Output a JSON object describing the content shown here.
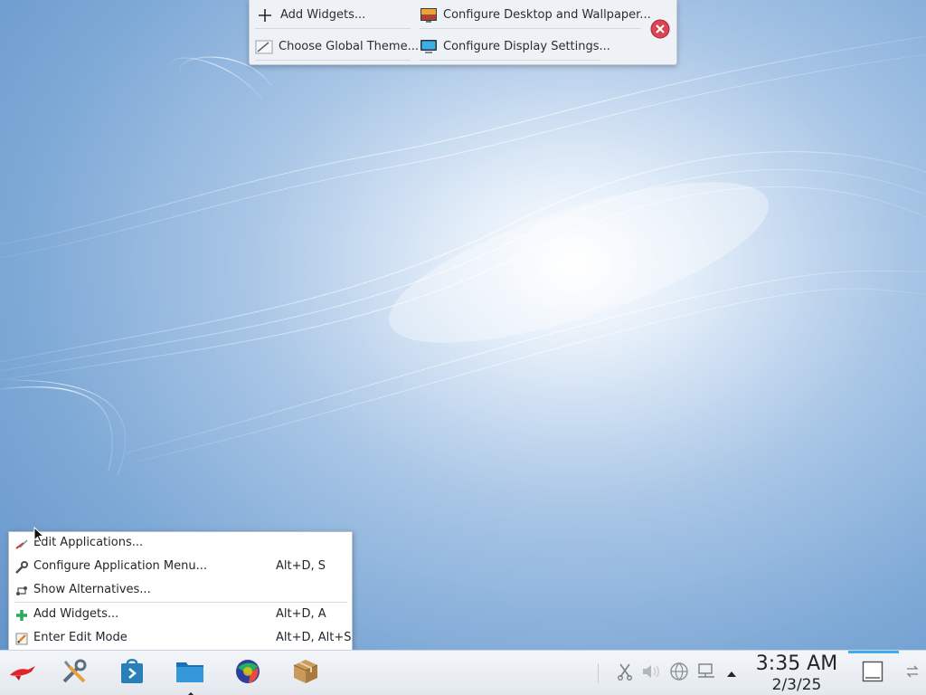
{
  "top_toolbar": {
    "add_widgets": "Add Widgets...",
    "configure_desktop": "Configure Desktop and Wallpaper...",
    "global_theme": "Choose Global Theme...",
    "display_settings": "Configure Display Settings..."
  },
  "context_menu": {
    "items": [
      {
        "label": "Edit Applications...",
        "shortcut": "",
        "icon": "edit-applications-icon"
      },
      {
        "label": "Configure Application Menu...",
        "shortcut": "Alt+D, S",
        "icon": "wrench-icon"
      },
      {
        "label": "Show Alternatives...",
        "shortcut": "",
        "icon": "alternatives-icon"
      },
      {
        "label": "Add Widgets...",
        "shortcut": "Alt+D, A",
        "icon": "plus-icon"
      },
      {
        "label": "Enter Edit Mode",
        "shortcut": "Alt+D, Alt+S",
        "icon": "pencil-icon"
      }
    ]
  },
  "taskbar": {
    "launchers": [
      "application-launcher-icon",
      "system-settings-icon",
      "discover-store-icon",
      "file-manager-icon",
      "web-browser-icon",
      "package-icon"
    ],
    "tray": [
      "clipboard-icon",
      "volume-icon",
      "network-icon",
      "display-icon",
      "expand-tray-icon"
    ],
    "clock_time": "3:35 AM",
    "clock_date": "2/3/25"
  },
  "colors": {
    "accent": "#3daee9",
    "close_red": "#da4453",
    "plus_green": "#27ae60"
  }
}
